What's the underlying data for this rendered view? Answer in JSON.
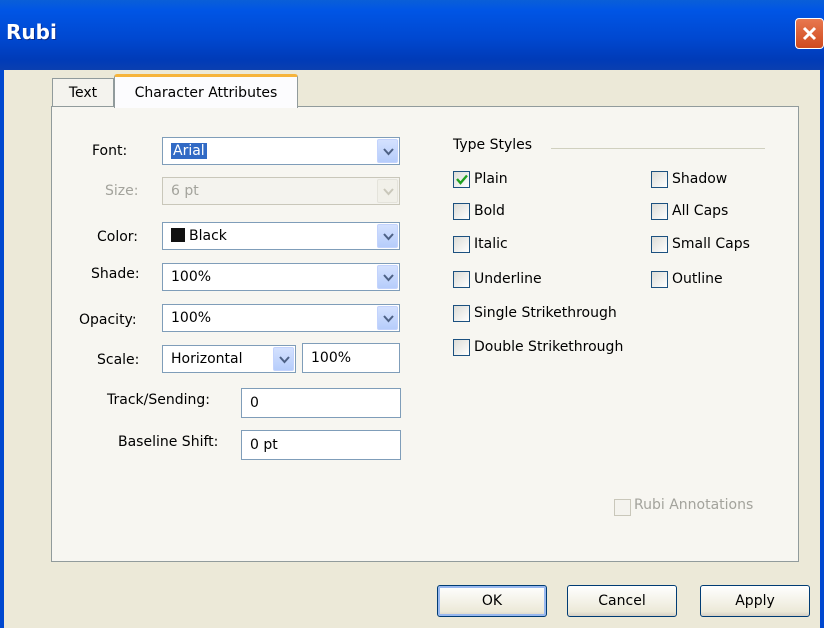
{
  "window": {
    "title": "Rubi"
  },
  "tabs": [
    {
      "label": "Text",
      "active": false
    },
    {
      "label": "Character Attributes",
      "active": true
    }
  ],
  "form": {
    "font": {
      "label": "Font:",
      "value": "Arial"
    },
    "size": {
      "label": "Size:",
      "value": "6 pt",
      "disabled": true
    },
    "color": {
      "label": "Color:",
      "value": "Black",
      "swatch": "#111111"
    },
    "shade": {
      "label": "Shade:",
      "value": "100%"
    },
    "opacity": {
      "label": "Opacity:",
      "value": "100%"
    },
    "scale": {
      "label": "Scale:",
      "direction": "Horizontal",
      "value": "100%"
    },
    "track": {
      "label": "Track/Sending:",
      "value": "0"
    },
    "baseline": {
      "label": "Baseline Shift:",
      "value": "0 pt"
    }
  },
  "type_styles": {
    "title": "Type Styles",
    "left": [
      {
        "label": "Plain",
        "checked": true
      },
      {
        "label": "Bold",
        "checked": false
      },
      {
        "label": "Italic",
        "checked": false
      },
      {
        "label": "Underline",
        "checked": false
      },
      {
        "label": "Single Strikethrough",
        "checked": false
      },
      {
        "label": "Double Strikethrough",
        "checked": false
      }
    ],
    "right": [
      {
        "label": "Shadow",
        "checked": false
      },
      {
        "label": "All Caps",
        "checked": false
      },
      {
        "label": "Small Caps",
        "checked": false
      },
      {
        "label": "Outline",
        "checked": false
      }
    ]
  },
  "rubi_annotations": {
    "label": "Rubi Annotations",
    "checked": false,
    "disabled": true
  },
  "buttons": {
    "ok": "OK",
    "cancel": "Cancel",
    "apply": "Apply"
  },
  "colors": {
    "titlebar": "#0048d0",
    "dialog_bg": "#ece9d8",
    "selection": "#316ac5",
    "active_tab_accent": "#f6b43c"
  }
}
